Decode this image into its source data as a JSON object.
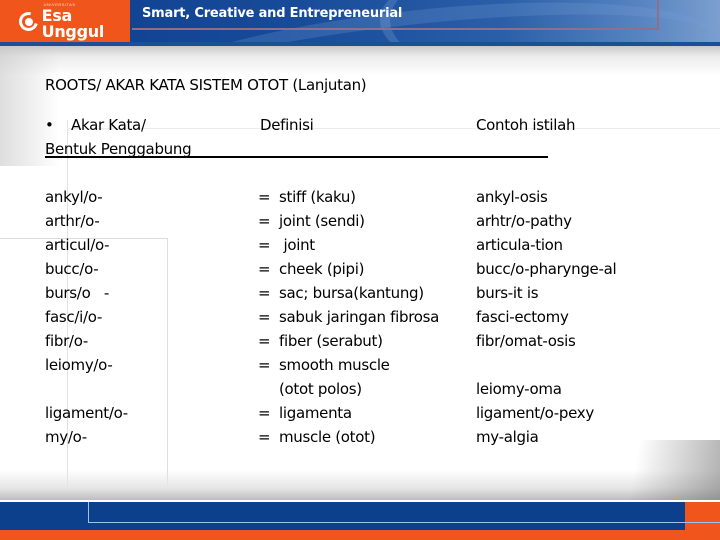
{
  "header": {
    "logo_small_text": "UNIVERSITAS",
    "logo_name": "Esa Unggul",
    "tagline": "Smart, Creative and Entrepreneurial",
    "colors": {
      "orange": "#f0561b",
      "blue": "#0d3f8e"
    }
  },
  "slide": {
    "title": "ROOTS/ AKAR KATA SISTEM OTOT (Lanjutan)",
    "columns": {
      "roots_bullet": "•",
      "roots_line1": "Akar Kata/",
      "roots_line2": "Bentuk Penggabung",
      "definition": "Definisi",
      "example": "Contoh istilah"
    },
    "equals_sign": "=",
    "rows": [
      {
        "root": "ankyl/o-",
        "definition": "stiff (kaku)",
        "example": "ankyl-osis"
      },
      {
        "root": "arthr/o-",
        "definition": "joint (sendi)",
        "example": "arhtr/o-pathy"
      },
      {
        "root": "articul/o-",
        "definition": " joint",
        "example": "articula-tion"
      },
      {
        "root": "bucc/o-",
        "definition": "cheek (pipi)",
        "example": "bucc/o-pharynge-al"
      },
      {
        "root": "burs/o   -",
        "definition": "sac; bursa(kantung)",
        "example": "burs-it is"
      },
      {
        "root": "fasc/i/o-",
        "definition": "sabuk jaringan fibrosa",
        "example": "fasci-ectomy"
      },
      {
        "root": "fibr/o-",
        "definition": "fiber (serabut)",
        "example": "fibr/omat-osis"
      },
      {
        "root": "leiomy/o-",
        "definition": "smooth muscle",
        "definition_cont": "(otot polos)",
        "example": "leiomy-oma"
      },
      {
        "root": "ligament/o-",
        "definition": "ligamenta",
        "example": "ligament/o-pexy"
      },
      {
        "root": "my/o-",
        "definition": "muscle (otot)",
        "example": "my-algia"
      }
    ]
  }
}
